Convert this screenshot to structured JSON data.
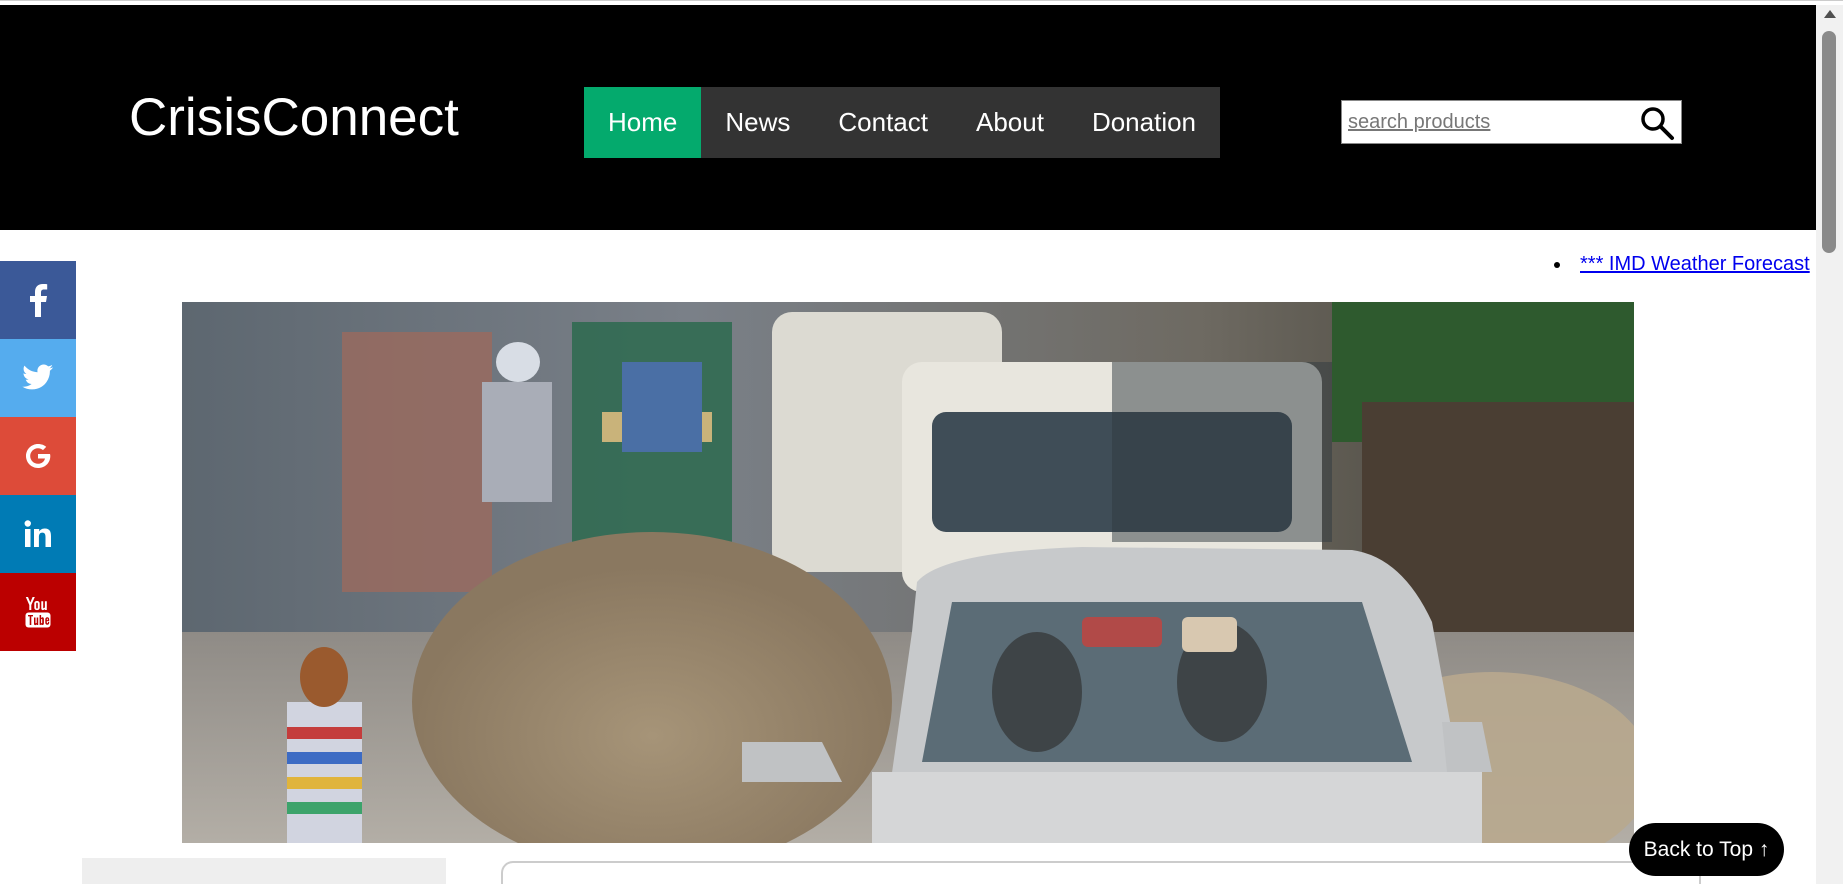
{
  "header": {
    "logo": "CrisisConnect",
    "nav": [
      {
        "label": "Home",
        "active": true
      },
      {
        "label": "News",
        "active": false
      },
      {
        "label": "Contact",
        "active": false
      },
      {
        "label": "About",
        "active": false
      },
      {
        "label": "Donation",
        "active": false
      }
    ],
    "search": {
      "placeholder": "search products",
      "value": ""
    }
  },
  "ticker": {
    "text": "*** IMD Weather Forecast"
  },
  "social": [
    {
      "icon": "facebook-icon",
      "label": "f",
      "color": "#3b5998"
    },
    {
      "icon": "twitter-icon",
      "label": "twitter",
      "color": "#55acee"
    },
    {
      "icon": "google-icon",
      "label": "G",
      "color": "#dd4b39"
    },
    {
      "icon": "linkedin-icon",
      "label": "in",
      "color": "#007bb5"
    },
    {
      "icon": "youtube-icon",
      "label": "You Tube",
      "color": "#bb0000"
    }
  ],
  "hero": {
    "subject": "flooded street with cars and rickshaws"
  },
  "back_to_top": "Back to Top ↑",
  "colors": {
    "header_bg": "#000000",
    "nav_bg": "#333333",
    "nav_active": "#04aa6d",
    "back_top_bg": "#000000"
  }
}
